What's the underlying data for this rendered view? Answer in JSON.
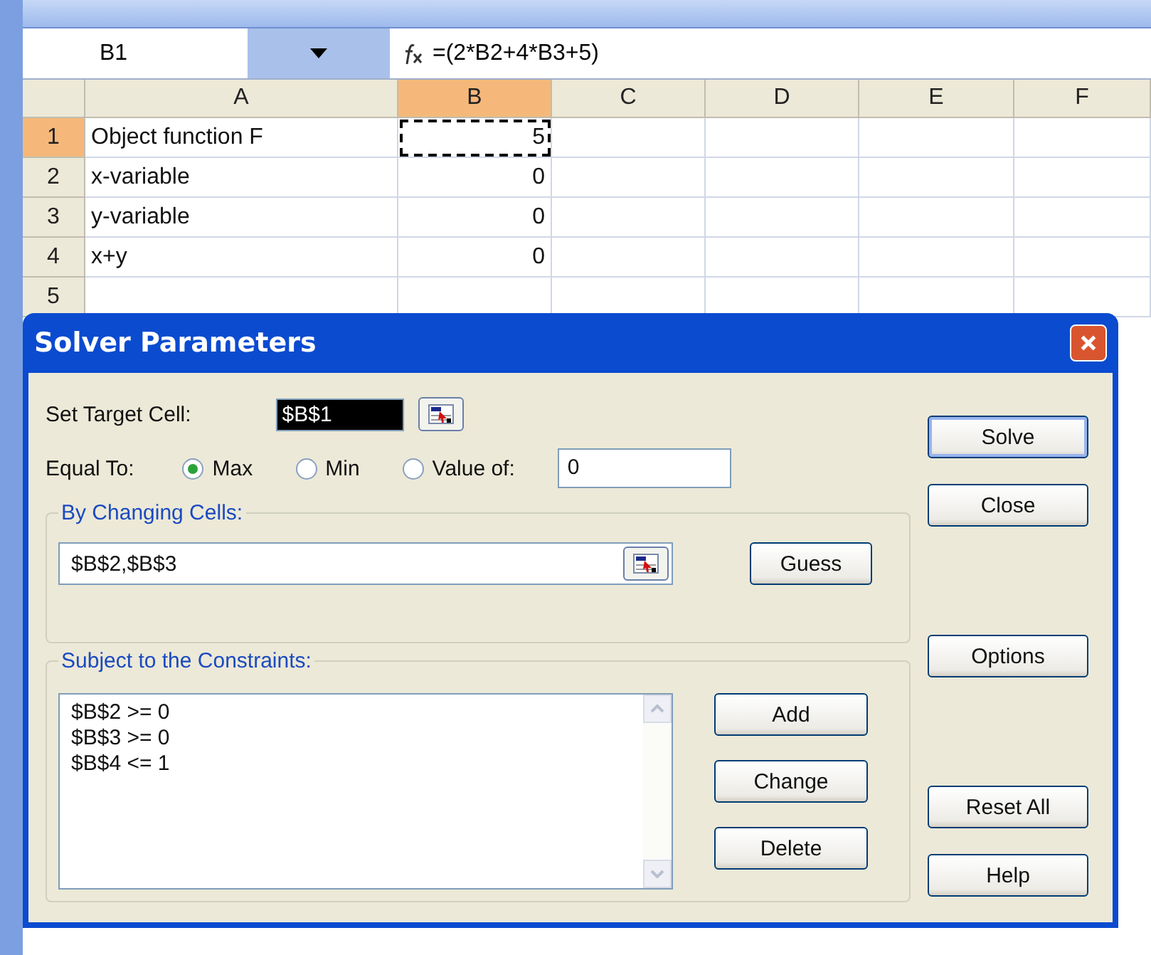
{
  "name_box": {
    "value": "B1"
  },
  "formula_bar": {
    "formula": "=(2*B2+4*B3+5)"
  },
  "columns": [
    {
      "label": "A",
      "selected": false
    },
    {
      "label": "B",
      "selected": true
    },
    {
      "label": "C",
      "selected": false
    },
    {
      "label": "D",
      "selected": false
    },
    {
      "label": "E",
      "selected": false
    },
    {
      "label": "F",
      "selected": false
    }
  ],
  "rows": [
    {
      "label": "1",
      "selected": true,
      "cells": [
        {
          "text": "Object function F",
          "marquee": false
        },
        {
          "text": "5",
          "marquee": true
        }
      ]
    },
    {
      "label": "2",
      "selected": false,
      "cells": [
        {
          "text": "x-variable",
          "marquee": false
        },
        {
          "text": "0",
          "marquee": false
        }
      ]
    },
    {
      "label": "3",
      "selected": false,
      "cells": [
        {
          "text": "y-variable",
          "marquee": false
        },
        {
          "text": "0",
          "marquee": false
        }
      ]
    },
    {
      "label": "4",
      "selected": false,
      "cells": [
        {
          "text": "x+y",
          "marquee": false
        },
        {
          "text": "0",
          "marquee": false
        }
      ]
    },
    {
      "label": "5",
      "selected": false
    }
  ],
  "dialog": {
    "title": "Solver Parameters",
    "target": {
      "label": "Set Target Cell:",
      "value": "$B$1"
    },
    "equal_to": {
      "label": "Equal To:",
      "options": [
        {
          "label": "Max",
          "selected": true
        },
        {
          "label": "Min",
          "selected": false
        },
        {
          "label": "Value of:",
          "selected": false
        }
      ],
      "value": "0"
    },
    "changing": {
      "legend": "By Changing Cells:",
      "value": "$B$2,$B$3",
      "button": "Guess"
    },
    "constraints": {
      "legend": "Subject to the Constraints:",
      "items": [
        "$B$2 >= 0",
        "$B$3 >= 0",
        "$B$4 <= 1"
      ],
      "buttons": [
        "Add",
        "Change",
        "Delete"
      ]
    },
    "side_buttons": [
      {
        "label": "Solve",
        "default": true
      },
      {
        "label": "Close",
        "default": false
      },
      {
        "label": "Options",
        "default": false
      },
      {
        "label": "Reset All",
        "default": false
      },
      {
        "label": "Help",
        "default": false
      }
    ]
  }
}
